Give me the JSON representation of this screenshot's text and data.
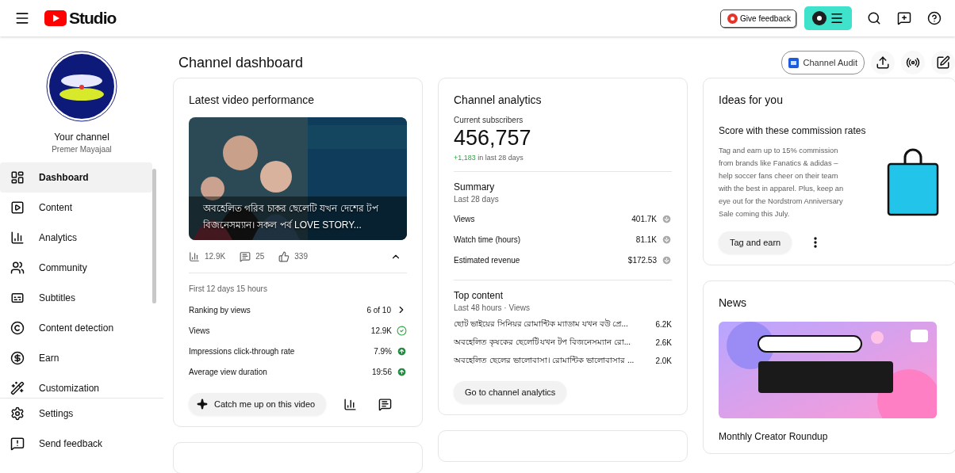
{
  "header": {
    "logo_text": "Studio",
    "feedback_button": "Give feedback"
  },
  "sidebar": {
    "channel_label": "Your channel",
    "channel_name": "Premer Mayajaal",
    "items": [
      {
        "label": "Dashboard",
        "kind": "dashboard",
        "selected": true
      },
      {
        "label": "Content",
        "kind": "content",
        "selected": false
      },
      {
        "label": "Analytics",
        "kind": "analytics",
        "selected": false
      },
      {
        "label": "Community",
        "kind": "community",
        "selected": false
      },
      {
        "label": "Subtitles",
        "kind": "subtitles",
        "selected": false
      },
      {
        "label": "Content detection",
        "kind": "copyright",
        "selected": false
      },
      {
        "label": "Earn",
        "kind": "earn",
        "selected": false
      },
      {
        "label": "Customization",
        "kind": "customization",
        "selected": false
      }
    ],
    "footer_items": [
      {
        "label": "Settings",
        "kind": "settings"
      },
      {
        "label": "Send feedback",
        "kind": "feedback"
      }
    ]
  },
  "page": {
    "title": "Channel dashboard",
    "audit_button": "Channel Audit"
  },
  "latest_video": {
    "title": "Latest video performance",
    "video_title": "অবহেলিত গরিব চাকর ছেলেটি যখন দেশের টপ বিজনেসম্যান। সকল পর্ব LOVE STORY...",
    "stats": [
      {
        "kind": "views",
        "value": "12.9K"
      },
      {
        "kind": "comments",
        "value": "25"
      },
      {
        "kind": "likes",
        "value": "339"
      }
    ],
    "expanded": true,
    "period": "First 12 days 15 hours",
    "metrics": [
      {
        "label": "Ranking by views",
        "value": "6 of 10",
        "kind": "chevron"
      },
      {
        "label": "Views",
        "value": "12.9K",
        "kind": "check"
      },
      {
        "label": "Impressions click-through rate",
        "value": "7.9%",
        "kind": "up"
      },
      {
        "label": "Average view duration",
        "value": "19:56",
        "kind": "up"
      }
    ],
    "catch_up_button": "Catch me up on this video"
  },
  "analytics": {
    "title": "Channel analytics",
    "subscribers_label": "Current subscribers",
    "subscribers": "456,757",
    "change": "+1,183",
    "change_suffix": "in last 28 days",
    "summary_title": "Summary",
    "summary_period": "Last 28 days",
    "summary": [
      {
        "label": "Views",
        "value": "401.7K",
        "kind": "down"
      },
      {
        "label": "Watch time (hours)",
        "value": "81.1K",
        "kind": "down"
      },
      {
        "label": "Estimated revenue",
        "value": "$172.53",
        "kind": "down"
      }
    ],
    "top_title": "Top content",
    "top_period": "Last 48 hours · Views",
    "top_content": [
      {
        "title": "ছোট ভাইয়ের সিনিয়র রোমান্টিক ম্যাডাম যখন বউ প্রে...",
        "views": "6.2K"
      },
      {
        "title": "অবহেলিত কৃষকের ছেলেটি যখন টপ বিজনেসম্যান রো...",
        "views": "2.6K"
      },
      {
        "title": "অবহেলিত ছেলের ভালোবাসা। রোমান্টিক ভালোবাসার ...",
        "views": "2.0K"
      }
    ],
    "button": "Go to channel analytics"
  },
  "ideas": {
    "title": "Ideas for you",
    "heading": "Score with these commission rates",
    "body": "Tag and earn up to 15% commission from brands like Fanatics & adidas – help soccer fans cheer on their team with the best in apparel. Plus, keep an eye out for the Nordstrom Anniversary Sale coming this July.",
    "button": "Tag and earn"
  },
  "news": {
    "title": "News",
    "caption": "Monthly Creator Roundup"
  }
}
